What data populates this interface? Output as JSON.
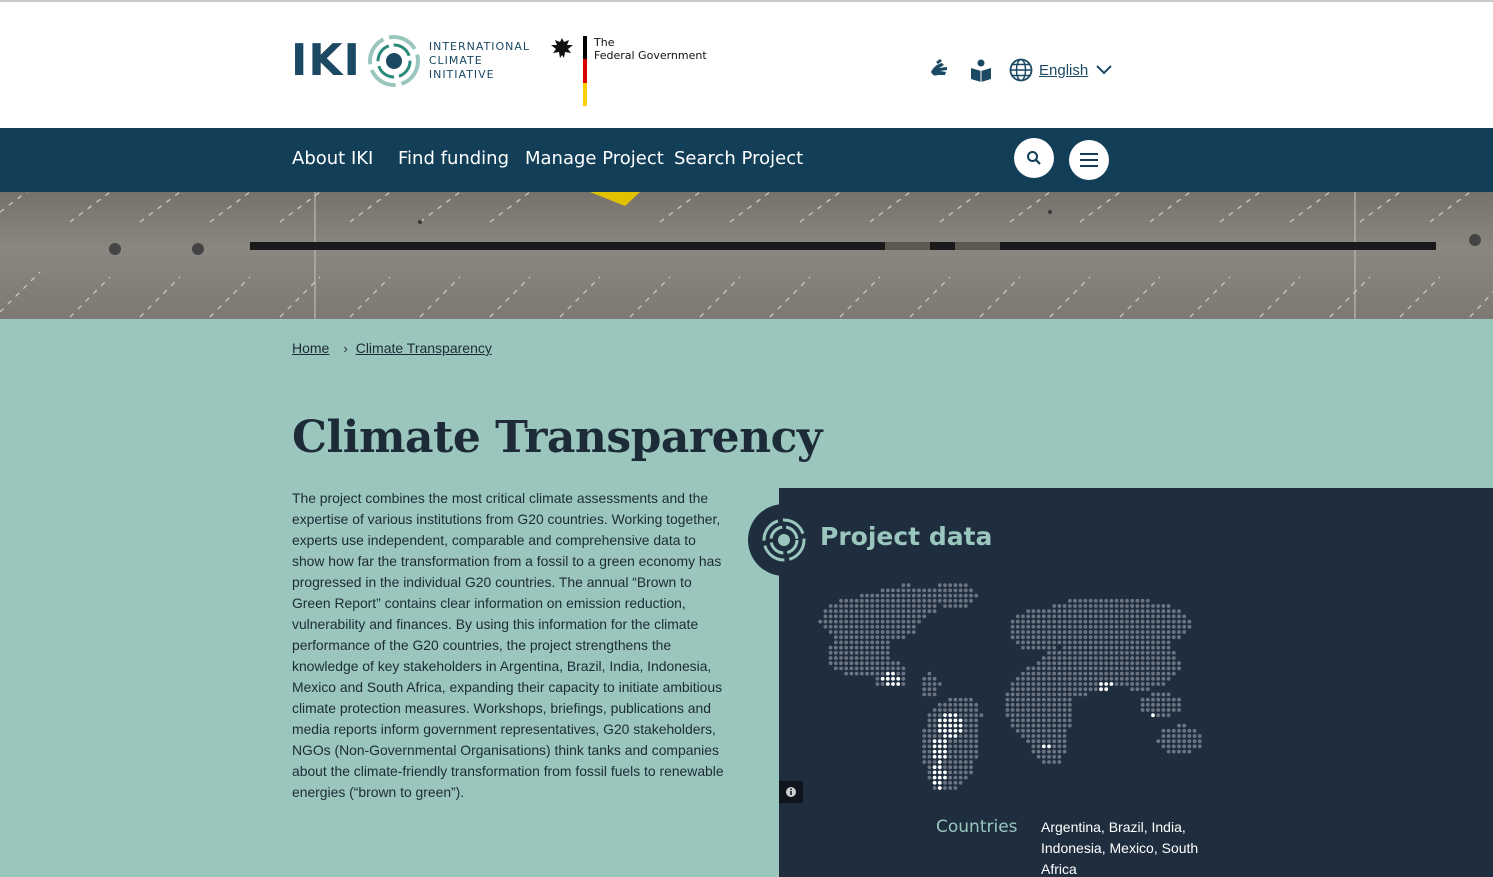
{
  "header": {
    "logo_word": "IKI",
    "logo_sub": [
      "INTERNATIONAL",
      "CLIMATE",
      "INITIATIVE"
    ],
    "fedgov_line1": "The",
    "fedgov_line2": "Federal Government",
    "tools": [
      {
        "icon": "sign-language-icon"
      },
      {
        "icon": "easy-language-icon"
      }
    ],
    "language": "English"
  },
  "nav": {
    "items": [
      "About IKI",
      "Find funding",
      "Manage Project",
      "Search Project"
    ],
    "search_icon": "search-icon",
    "menu_icon": "menu-icon"
  },
  "breadcrumb": {
    "home": "Home",
    "current": "Climate Transparency"
  },
  "page": {
    "title": "Climate Transparency",
    "body": "The project combines the most critical climate assessments and the expertise of various institutions from G20 countries. Working together, experts use independent, comparable and comprehensive data to show how far the transformation from a fossil to a green economy has progressed in the individual G20 countries. The annual “Brown to Green Report” contains clear information on emission reduction, vulnerability and finances. By using this information for the climate performance of the G20 countries, the project strengthens the knowledge of key stakeholders in Argentina, Brazil, India, Indonesia, Mexico and South Africa, expanding their capacity to initiate ambitious climate protection measures. Workshops, briefings, publications and media reports inform government representatives, G20 stakeholders, NGOs (Non-Governmental Organisations) think tanks and companies about the climate-friendly transformation from fossil fuels to renewable energies (“brown to green”)."
  },
  "project_data": {
    "title": "Project data",
    "countries_label": "Countries",
    "countries_value": "Argentina, Brazil, India, Indonesia, Mexico, South Africa",
    "info_icon": "info-icon"
  },
  "colors": {
    "nav_bg": "#123e57",
    "page_bg": "#9ac6bd",
    "panel_bg": "#1e2e3f",
    "accent": "#9ac6bd"
  }
}
